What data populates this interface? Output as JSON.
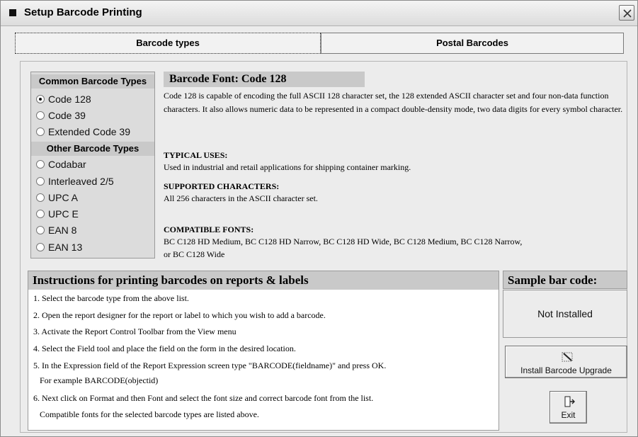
{
  "window": {
    "title": "Setup Barcode Printing"
  },
  "tabs": [
    {
      "label": "Barcode types",
      "active": true
    },
    {
      "label": "Postal Barcodes",
      "active": false
    }
  ],
  "barcode_types": {
    "common_header": "Common Barcode Types",
    "common": [
      {
        "label": "Code 128",
        "selected": true
      },
      {
        "label": "Code 39",
        "selected": false
      },
      {
        "label": "Extended Code 39",
        "selected": false
      }
    ],
    "other_header": "Other Barcode Types",
    "other": [
      {
        "label": "Codabar",
        "selected": false
      },
      {
        "label": "Interleaved 2/5",
        "selected": false
      },
      {
        "label": "UPC A",
        "selected": false
      },
      {
        "label": "UPC E",
        "selected": false
      },
      {
        "label": "EAN 8",
        "selected": false
      },
      {
        "label": "EAN 13",
        "selected": false
      }
    ]
  },
  "font_info": {
    "title": "Barcode Font: Code 128",
    "description": "Code 128 is capable of encoding the full ASCII 128 character set, the 128 extended ASCII character set and four non-data function characters.  It also allows numeric data to be represented in a compact double-density mode, two data digits for every symbol character.",
    "typical_uses_label": "TYPICAL USES:",
    "typical_uses": "Used in industrial and retail applications for shipping container marking.",
    "supported_label": "SUPPORTED CHARACTERS:",
    "supported": "All 256 characters in the ASCII character set.",
    "fonts_label": "COMPATIBLE FONTS:",
    "fonts": "BC C128 HD Medium, BC C128 HD Narrow, BC C128 HD Wide, BC C128 Medium, BC C128 Narrow, or BC C128 Wide"
  },
  "instructions": {
    "title": "Instructions for printing barcodes on reports & labels",
    "lines": [
      "1. Select the barcode type from the above list.",
      "2. Open the report designer for the report or label to which you wish to add a barcode.",
      "3. Activate the Report Control Toolbar from the View menu",
      "4. Select the Field tool and place the field on the form in the desired location.",
      "5. In the Expression field of the Report Expression screen type \"BARCODE(fieldname)\" and press OK.",
      "   For example BARCODE(objectid)",
      "6. Next click on Format and then Font and select the font size and correct barcode font from the list.",
      "   Compatible fonts for the selected barcode types are listed above."
    ]
  },
  "sample": {
    "title": "Sample bar code:",
    "status": "Not Installed"
  },
  "buttons": {
    "install": "Install Barcode Upgrade",
    "exit": "Exit"
  }
}
